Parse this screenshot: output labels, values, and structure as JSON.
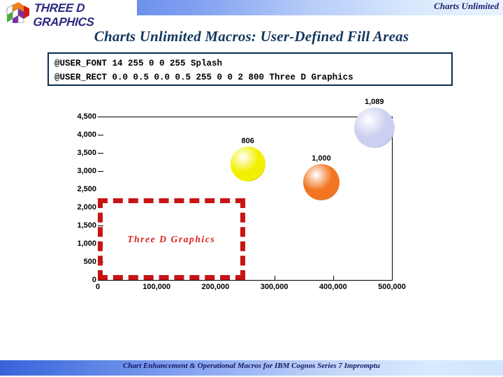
{
  "header": {
    "logo_text": "THREE D GRAPHICS",
    "logo_icon": "three-d-cube-logo",
    "right_label": "Charts Unlimited"
  },
  "title": "Charts Unlimited Macros: User-Defined Fill Areas",
  "code_box": {
    "line1": "@USER_FONT 14 255 0 0 255 Splash",
    "line2": "@USER_RECT 0.0 0.5 0.0 0.5 255 0 0 2 800 Three D Graphics"
  },
  "footer": {
    "text": "Chart Enhancement & Operational Macros for IBM Cognos Series 7 Impromptu"
  },
  "colors": {
    "header_gradient_start": "#3a62d8",
    "header_gradient_end": "#e9f3ff",
    "title": "#14375e",
    "code_border": "#0d2b52",
    "user_rect": "#c81414",
    "user_rect_text": "#dd2020",
    "bubble_yellow": "#f2f000",
    "bubble_orange": "#f2741e",
    "bubble_lavender": "#ccd0f0"
  },
  "chart_data": {
    "type": "scatter",
    "title": "",
    "xlabel": "",
    "ylabel": "",
    "xlim": [
      0,
      500000
    ],
    "ylim": [
      0,
      4500
    ],
    "grid": false,
    "legend": "none",
    "xticks": [
      "0",
      "100,000",
      "200,000",
      "300,000",
      "400,000",
      "500,000"
    ],
    "xtick_values": [
      0,
      100000,
      200000,
      300000,
      400000,
      500000
    ],
    "yticks": [
      "0",
      "500",
      "1,000",
      "1,500",
      "2,000",
      "2,500",
      "3,000",
      "3,500",
      "4,000",
      "4,500"
    ],
    "ytick_values": [
      0,
      500,
      1000,
      1500,
      2000,
      2500,
      3000,
      3500,
      4000,
      4500
    ],
    "points": [
      {
        "label": "806",
        "x": 255000,
        "y": 3200,
        "size": 50,
        "color": "#f2f000"
      },
      {
        "label": "1,000",
        "x": 380000,
        "y": 2700,
        "size": 52,
        "color": "#f2741e"
      },
      {
        "label": "1,089",
        "x": 470000,
        "y": 4200,
        "size": 58,
        "color": "#ccd0f0"
      }
    ],
    "annotations": [
      {
        "name": "user-defined-fill-rectangle",
        "text": "Three D Graphics",
        "x0": 0,
        "x1": 250000,
        "y0": 0,
        "y1": 2250,
        "border_color": "#c81414",
        "border_style": "dashed",
        "text_color": "#dd2020"
      }
    ]
  }
}
